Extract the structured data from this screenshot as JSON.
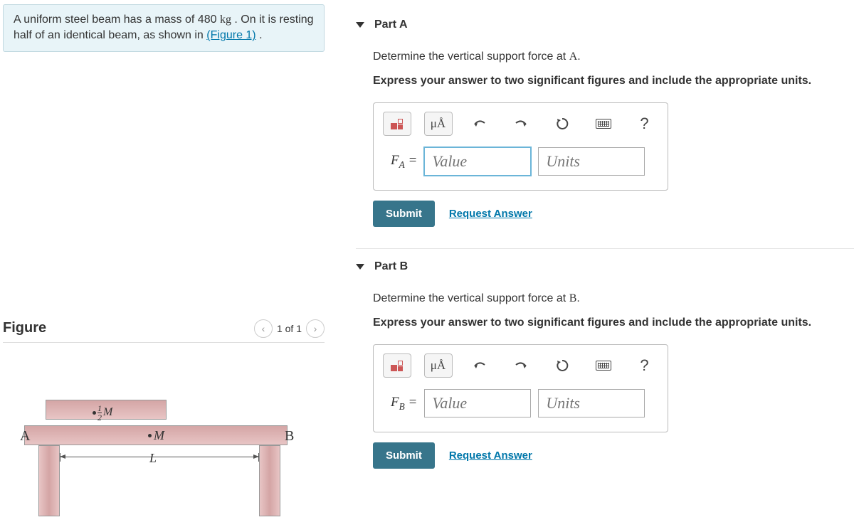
{
  "problem": {
    "text_pre": "A uniform steel beam has a mass of 480 ",
    "unit": "kg",
    "text_mid": " . On it is resting half of an identical beam, as shown in ",
    "link": "(Figure 1)",
    "text_post": " ."
  },
  "figure": {
    "title": "Figure",
    "counter": "1 of 1",
    "labels": {
      "A": "A",
      "B": "B",
      "L": "L",
      "M": "M",
      "half_num": "1",
      "half_den": "2"
    }
  },
  "parts": [
    {
      "id": "A",
      "title": "Part A",
      "prompt_pre": "Determine the vertical support force at ",
      "prompt_var": "A",
      "prompt_post": ".",
      "instr": "Express your answer to two significant figures and include the appropriate units.",
      "var_base": "F",
      "var_sub": "A",
      "value_ph": "Value",
      "units_ph": "Units",
      "submit": "Submit",
      "request": "Request Answer"
    },
    {
      "id": "B",
      "title": "Part B",
      "prompt_pre": "Determine the vertical support force at ",
      "prompt_var": "B",
      "prompt_post": ".",
      "instr": "Express your answer to two significant figures and include the appropriate units.",
      "var_base": "F",
      "var_sub": "B",
      "value_ph": "Value",
      "units_ph": "Units",
      "submit": "Submit",
      "request": "Request Answer"
    }
  ],
  "toolbar": {
    "units_tip": "μÅ",
    "help": "?"
  }
}
